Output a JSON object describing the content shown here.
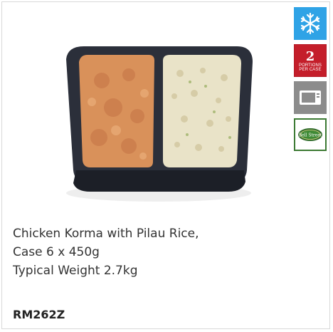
{
  "product": {
    "name_line1": "Chicken Korma with Pilau Rice,",
    "name_line2": "Case 6 x 450g",
    "name_line3": "Typical Weight 2.7kg",
    "code": "RM262Z"
  },
  "badges": {
    "frozen_icon": "snowflake-icon",
    "portions_number": "2",
    "portions_text_line1": "PORTIONS",
    "portions_text_line2": "PER CASE",
    "microwave_icon": "microwave-icon",
    "brand_logo_text": "Bell Street"
  },
  "colors": {
    "frozen_badge": "#2fa3e6",
    "portions_badge": "#c41e2a",
    "microwave_badge": "#8c8c8c",
    "brand_badge": "#3c7a33"
  }
}
